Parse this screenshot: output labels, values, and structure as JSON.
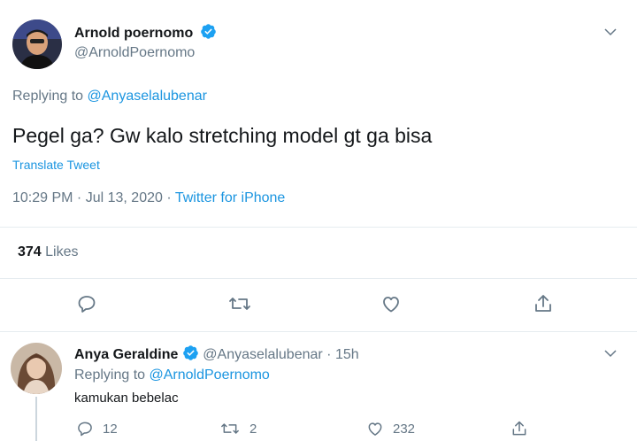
{
  "main_tweet": {
    "author_name": "Arnold poernomo",
    "author_handle": "@ArnoldPoernomo",
    "replying_prefix": "Replying to",
    "replying_to": "@Anyaselalubenar",
    "text": "Pegel ga? Gw kalo stretching model gt ga bisa",
    "translate_label": "Translate Tweet",
    "timestamp": "10:29 PM · Jul 13, 2020",
    "separator": " · ",
    "source": "Twitter for iPhone",
    "likes_count": "374",
    "likes_label": "Likes"
  },
  "reply_tweet": {
    "author_name": "Anya Geraldine",
    "author_handle": "@Anyaselalubenar",
    "time": "· 15h",
    "replying_prefix": "Replying to",
    "replying_to": "@ArnoldPoernomo",
    "text": "kamukan bebelac",
    "reply_count": "12",
    "retweet_count": "2",
    "like_count": "232"
  },
  "colors": {
    "link": "#1b95e0",
    "muted": "#657786",
    "text": "#14171a",
    "divider": "#e6ecf0"
  },
  "icons": [
    "verified-badge-icon",
    "chevron-down-icon",
    "reply-icon",
    "retweet-icon",
    "like-icon",
    "share-icon"
  ]
}
